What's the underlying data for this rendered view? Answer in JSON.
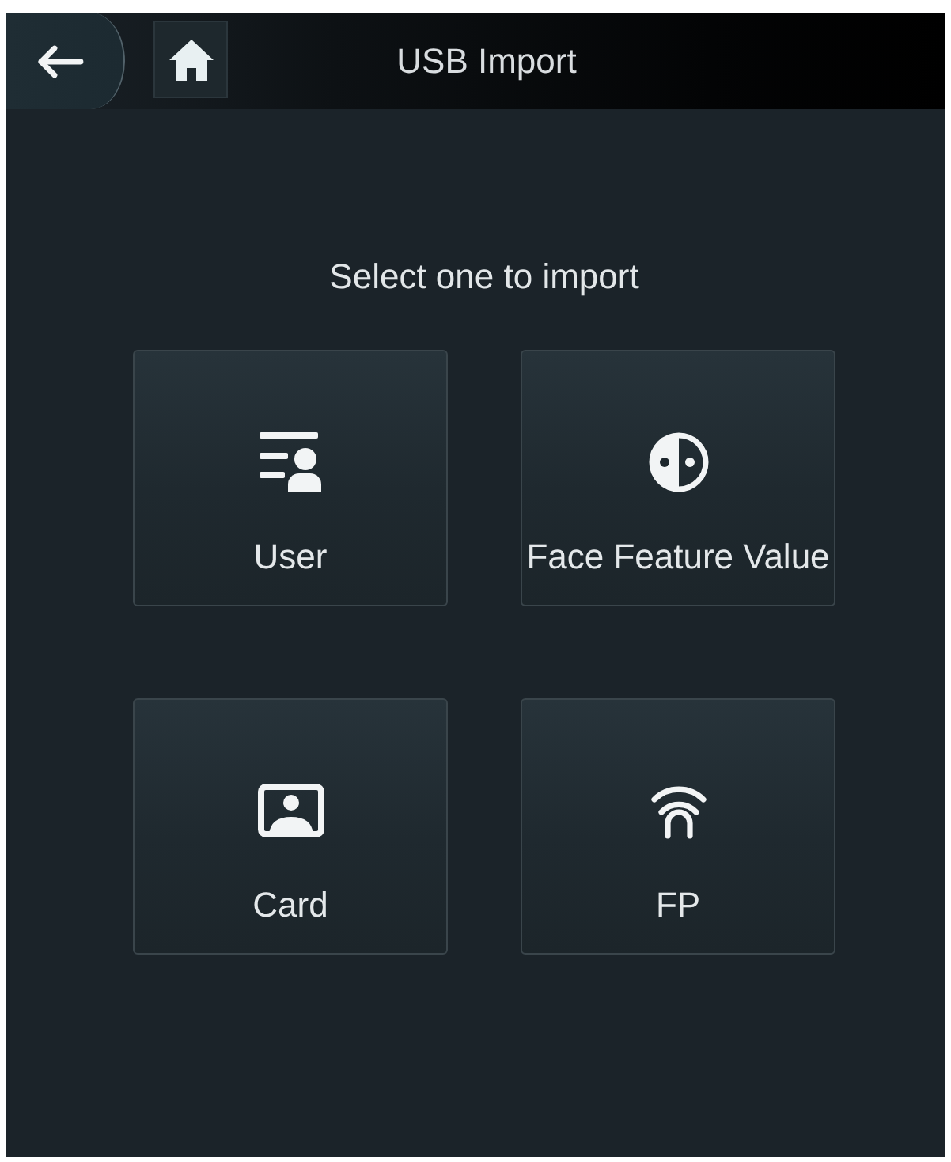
{
  "header": {
    "title": "USB Import"
  },
  "prompt": "Select one to import",
  "options": [
    {
      "kind": "user",
      "label": "User"
    },
    {
      "kind": "face",
      "label": "Face Feature Value"
    },
    {
      "kind": "card",
      "label": "Card"
    },
    {
      "kind": "fingerprint",
      "label": "FP"
    }
  ]
}
